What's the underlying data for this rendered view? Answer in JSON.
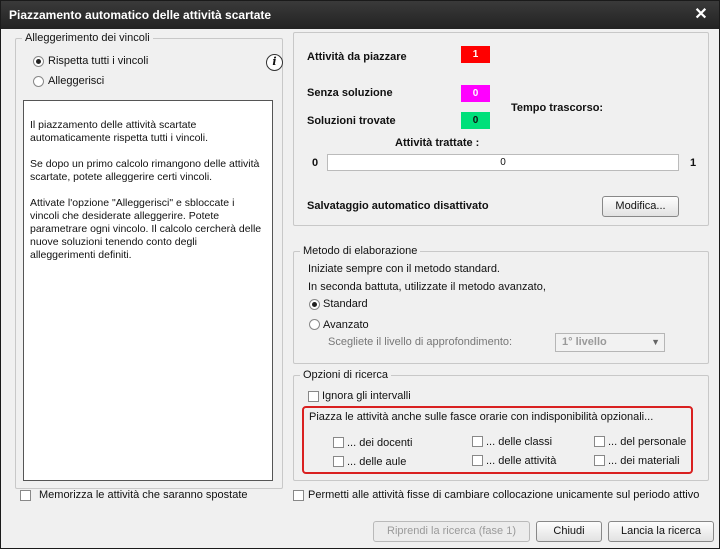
{
  "window": {
    "title": "Piazzamento automatico delle attività scartate",
    "close": "✕"
  },
  "constraints": {
    "legend": "Alleggerimento dei vincoli",
    "options": [
      "Rispetta tutti i vincoli",
      "Alleggerisci"
    ],
    "selected": 0,
    "info_paragraphs": [
      "Il piazzamento delle attività scartate automaticamente rispetta tutti i vincoli.",
      "Se dopo un primo calcolo rimangono delle attività scartate, potete alleggerire certi vincoli.",
      "Attivate l'opzione \"Alleggerisci\" e sbloccate i vincoli che desiderate alleggerire. Potete parametrare ogni vincolo. Il calcolo cercherà delle nuove soluzioni tenendo conto degli alleggerimenti definiti."
    ]
  },
  "status": {
    "to_place_label": "Attività da piazzare",
    "to_place_value": "1",
    "no_solution_label": "Senza soluzione",
    "no_solution_value": "0",
    "solutions_label": "Soluzioni trovate",
    "solutions_value": "0",
    "elapsed_label": "Tempo trascorso:",
    "processed_label": "Attività trattate   :",
    "progress_min": "0",
    "progress_value": "0",
    "progress_max": "1",
    "progress_fraction": 0,
    "autosave_label": "Salvataggio automatico disattivato",
    "modify_button": "Modifica...",
    "colors": {
      "to_place": "#ff0000",
      "no_solution": "#ff00ff",
      "solutions": "#00e07a"
    }
  },
  "method": {
    "legend": "Metodo di elaborazione",
    "line1": "Iniziate sempre con il metodo standard.",
    "line2": "In seconda battuta, utilizzate il metodo avanzato,",
    "options": [
      "Standard",
      "Avanzato"
    ],
    "selected": 0,
    "depth_label": "Scegliete il livello di approfondimento:",
    "depth_value": "1° livello"
  },
  "search": {
    "legend": "Opzioni di ricerca",
    "ignore_intervals": "Ignora gli intervalli",
    "place_on_slots": "Piazza le attività anche sulle fasce orarie con indisponibilità opzionali...",
    "teachers": "... dei docenti",
    "classes": "... delle classi",
    "staff": "... del personale",
    "rooms": "... delle aule",
    "activities": "... delle attività",
    "materials": "... dei materiali"
  },
  "footer": {
    "remember_moved": "Memorizza le attività che saranno spostate",
    "allow_fixed": "Permetti alle attività fisse di cambiare collocazione unicamente sul periodo attivo",
    "resume_button": "Riprendi la ricerca (fase 1)",
    "close_button": "Chiudi",
    "launch_button": "Lancia la ricerca"
  }
}
